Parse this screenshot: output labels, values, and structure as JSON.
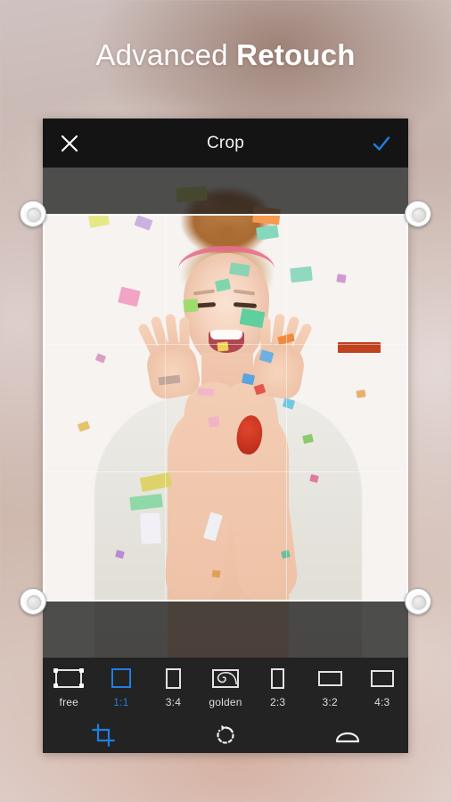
{
  "promo": {
    "headline_light": "Advanced",
    "headline_bold": "Retouch",
    "background_color": "#cdb6ab"
  },
  "app": {
    "topbar": {
      "close_icon": "close-icon",
      "title": "Crop",
      "confirm_icon": "check-icon",
      "confirm_color": "#1f7fe0",
      "background_color": "#141414"
    },
    "editor": {
      "crop_overlay": {
        "grid": "rule-of-thirds",
        "handles": 4,
        "dim_color": "rgba(30,30,30,0.78)",
        "border_color": "#ffffff"
      },
      "photo_description": "Smiling young woman with auburn hair bun and party headband surrounded by colorful confetti"
    },
    "ratios": {
      "selected": "1:1",
      "accent_color": "#1f7fe0",
      "items": [
        {
          "label": "free",
          "icon": "free-crop-icon",
          "shape": "free"
        },
        {
          "label": "1:1",
          "icon": "square-icon",
          "shape": "square"
        },
        {
          "label": "3:4",
          "icon": "portrait-icon",
          "shape": "portrait34"
        },
        {
          "label": "golden",
          "icon": "golden-ratio-icon",
          "shape": "golden"
        },
        {
          "label": "2:3",
          "icon": "portrait-icon",
          "shape": "portrait23"
        },
        {
          "label": "3:2",
          "icon": "landscape-icon",
          "shape": "land32"
        },
        {
          "label": "4:3",
          "icon": "landscape-icon",
          "shape": "land43"
        }
      ]
    },
    "tools": [
      {
        "name": "crop",
        "icon": "crop-tool-icon",
        "active": true
      },
      {
        "name": "rotate",
        "icon": "rotate-tool-icon",
        "active": false
      },
      {
        "name": "perspective",
        "icon": "perspective-tool-icon",
        "active": false
      }
    ]
  }
}
